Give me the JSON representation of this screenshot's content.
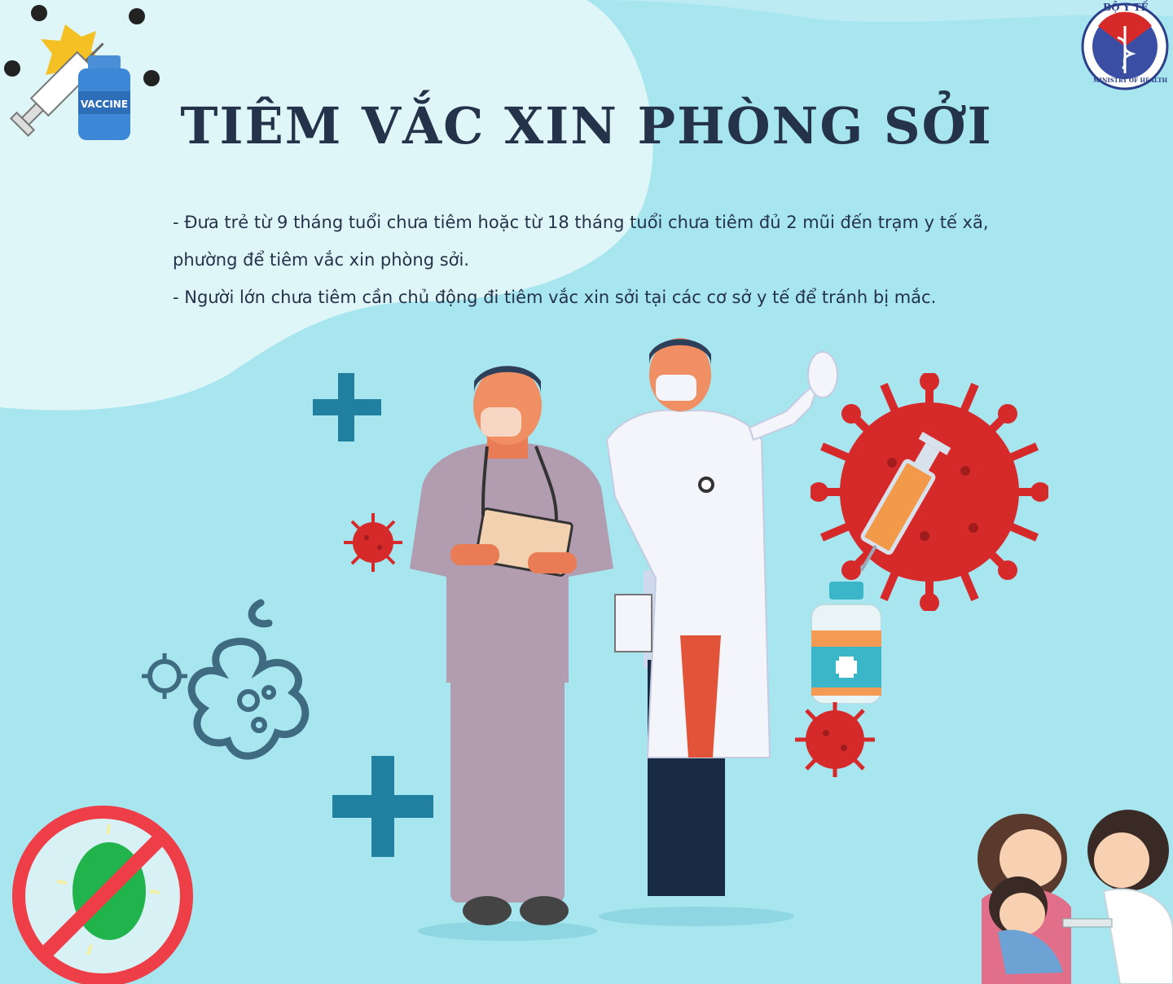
{
  "title": "TIÊM VẮC XIN PHÒNG SỞI",
  "paragraphs": [
    "- Đưa trẻ từ 9 tháng tuổi chưa tiêm hoặc từ 18 tháng tuổi chưa tiêm đủ 2 mũi đến trạm y tế xã,",
    "phường để tiêm vắc xin phòng sởi.",
    "- Người lớn chưa tiêm cần chủ động đi tiêm vắc xin sởi tại các cơ sở y tế để tránh bị mắc."
  ],
  "vaccine_label": "VACCINE",
  "logo": {
    "top_text": "BỘ Y TẾ",
    "bottom_text": "MINISTRY OF HEALTH"
  },
  "colors": {
    "background": "#a7e5ef",
    "blob": "#dff6f9",
    "title": "#24324a",
    "virus": "#d62a2a",
    "plus": "#217f9f",
    "logo": "#2b3f8a"
  },
  "icons": [
    "syringe-icon",
    "vaccine-bottle-icon",
    "plus-icon",
    "virus-icon",
    "ban-sign-icon",
    "caduceus-icon"
  ]
}
